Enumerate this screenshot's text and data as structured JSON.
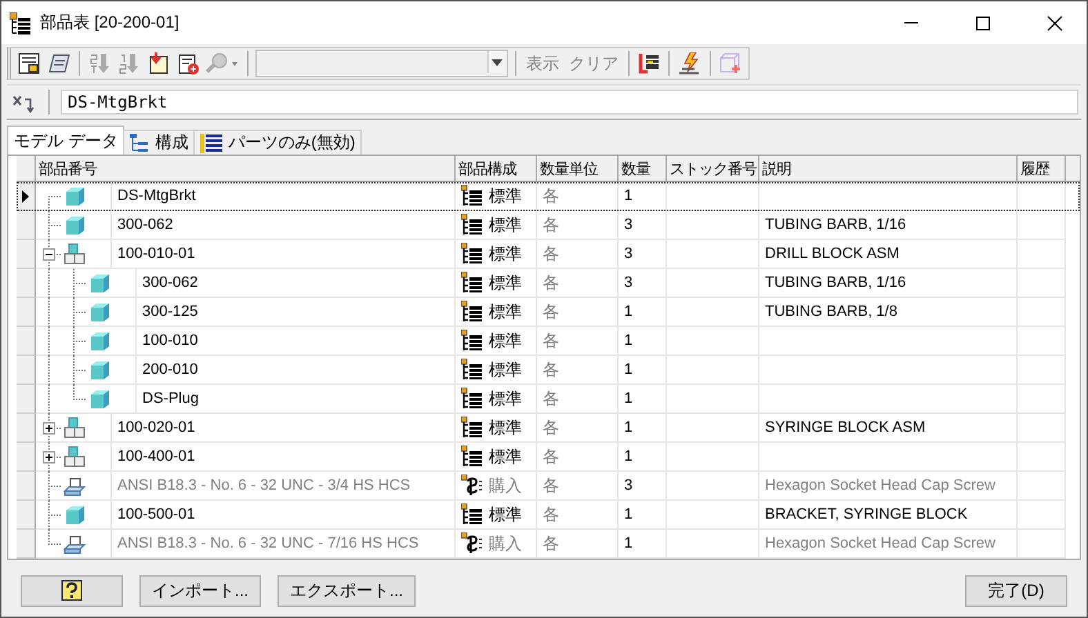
{
  "window": {
    "title": "部品表 [20-200-01]"
  },
  "toolbar": {
    "labels": [
      {
        "text": "表示",
        "disabled": true
      },
      {
        "text": "クリア",
        "disabled": true
      }
    ]
  },
  "filter": {
    "value": "DS-MtgBrkt"
  },
  "tabs": [
    {
      "label": "モデル データ",
      "selected": true,
      "kind": "model"
    },
    {
      "label": "構成",
      "selected": false,
      "kind": "structure"
    },
    {
      "label": "パーツのみ(無効)",
      "selected": false,
      "kind": "parts"
    }
  ],
  "table": {
    "columns": [
      "部品番号",
      "部品構成",
      "数量単位",
      "数量",
      "ストック番号",
      "説明",
      "履歴"
    ],
    "rows": [
      {
        "part_number": "DS-MtgBrkt",
        "kind": "part",
        "structure": "標準",
        "unit": "各",
        "qty": "1",
        "selected": true
      },
      {
        "part_number": "300-062",
        "kind": "part",
        "structure": "標準",
        "unit": "各",
        "qty": "3",
        "description": "TUBING BARB, 1/16",
        "selected": false
      },
      {
        "part_number": "100-010-01",
        "kind": "assembly",
        "structure": "標準",
        "unit": "各",
        "qty": "3",
        "description": "DRILL BLOCK ASM",
        "selected": false,
        "expanded": true,
        "children": [
          {
            "part_number": "300-062",
            "kind": "part",
            "structure": "標準",
            "unit": "各",
            "qty": "3",
            "description": "TUBING BARB, 1/16",
            "selected": false
          },
          {
            "part_number": "300-125",
            "kind": "part",
            "structure": "標準",
            "unit": "各",
            "qty": "1",
            "description": "TUBING BARB, 1/8",
            "selected": false
          },
          {
            "part_number": "100-010",
            "kind": "part",
            "structure": "標準",
            "unit": "各",
            "qty": "1",
            "selected": false
          },
          {
            "part_number": "200-010",
            "kind": "part",
            "structure": "標準",
            "unit": "各",
            "qty": "1",
            "selected": false
          },
          {
            "part_number": "DS-Plug",
            "kind": "part",
            "structure": "標準",
            "unit": "各",
            "qty": "1",
            "selected": false
          }
        ]
      },
      {
        "part_number": "100-020-01",
        "kind": "assembly",
        "structure": "標準",
        "unit": "各",
        "qty": "1",
        "description": "SYRINGE BLOCK ASM",
        "selected": false,
        "expanded": false
      },
      {
        "part_number": "100-400-01",
        "kind": "assembly",
        "structure": "標準",
        "unit": "各",
        "qty": "1",
        "selected": false,
        "expanded": false
      },
      {
        "part_number": "ANSI B18.3 - No. 6 - 32 UNC - 3/4 HS HCS",
        "kind": "purchased",
        "structure": "購入",
        "unit": "各",
        "qty": "3",
        "description": "Hexagon Socket Head Cap Screw",
        "selected": false
      },
      {
        "part_number": "100-500-01",
        "kind": "part",
        "structure": "標準",
        "unit": "各",
        "qty": "1",
        "description": "BRACKET, SYRINGE BLOCK",
        "selected": false
      },
      {
        "part_number": "ANSI B18.3 - No. 6 - 32 UNC - 7/16 HS HCS",
        "kind": "purchased",
        "structure": "購入",
        "unit": "各",
        "qty": "1",
        "description": "Hexagon Socket Head Cap Screw",
        "selected": false
      }
    ]
  },
  "footer": {
    "import_label": "インポート...",
    "export_label": "エクスポート...",
    "done_label": "完了(D)"
  }
}
